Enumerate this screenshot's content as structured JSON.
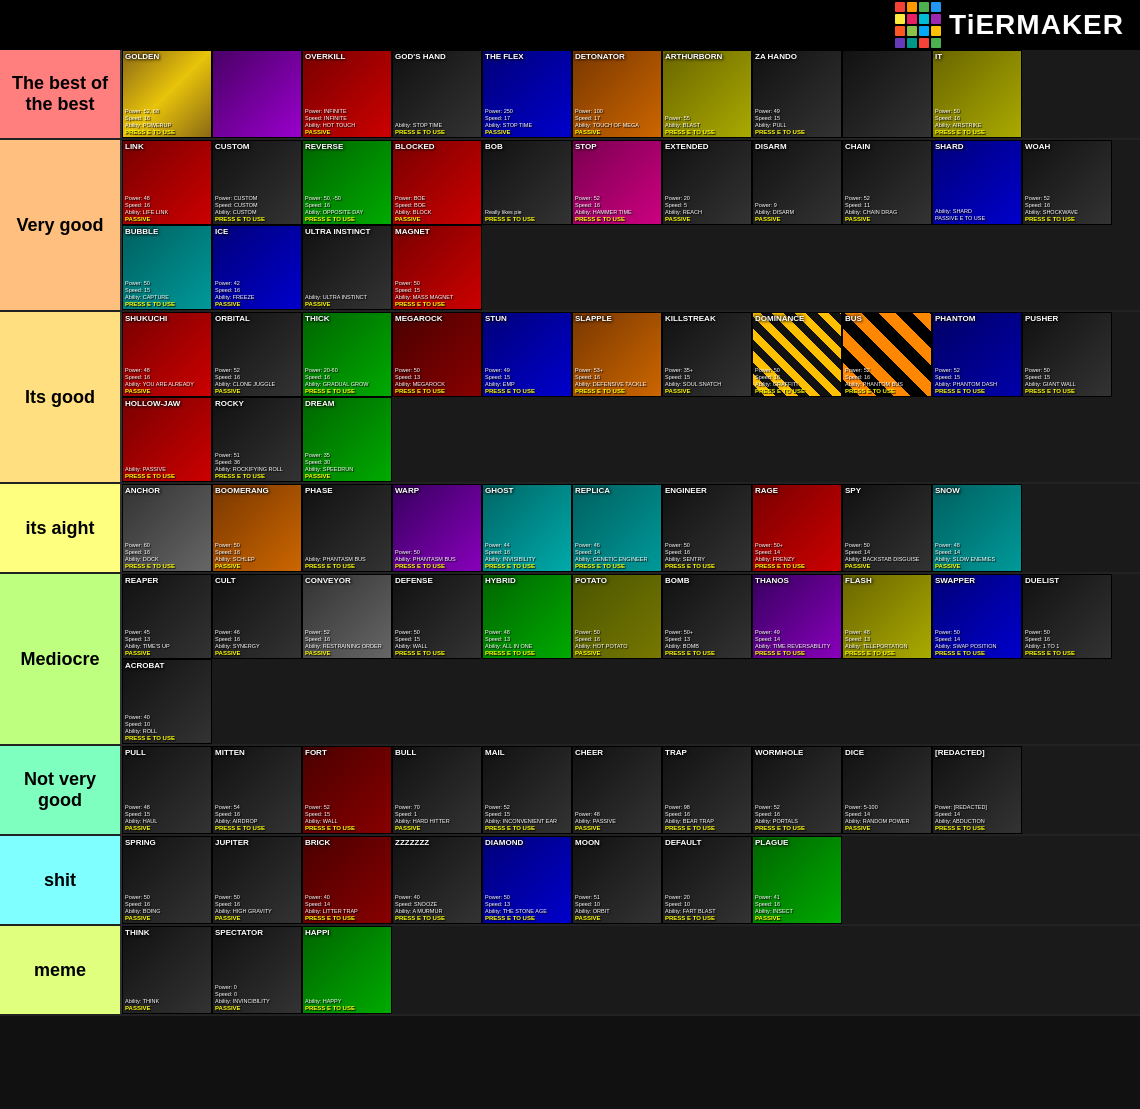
{
  "header": {
    "title": "TiERMAKER",
    "logo_colors": [
      "#f44",
      "#f84",
      "#4f4",
      "#44f",
      "#ff4",
      "#f4f",
      "#4ff",
      "#fff",
      "#f44",
      "#4f4",
      "#44f",
      "#ff4",
      "#f4f",
      "#4ff",
      "#f44",
      "#4f4"
    ]
  },
  "tiers": [
    {
      "id": "s",
      "label": "The best of the best",
      "color": "#ff7f7f",
      "items": [
        {
          "name": "GOLDEN",
          "stats": "Power: 52, 68\nSpeed: 16\nAbility: POWERUP\nPRESS E TO USE",
          "bg": "golden"
        },
        {
          "name": "",
          "stats": "",
          "bg": "purple-checker"
        },
        {
          "name": "OVERKILL",
          "stats": "Power: INFINITE\nSpeed: INFINITE\nAbility: HOT TOUCH\nPASSIVE",
          "bg": "red"
        },
        {
          "name": "GOD'S HAND",
          "stats": "Ability: STOP TIME\nPRESS E TO USE",
          "bg": "dark"
        },
        {
          "name": "THE FLEX",
          "stats": "Power: 250\nSpeed: 17\nAbility: STOP TIME\nPASSIVE",
          "bg": "blue"
        },
        {
          "name": "DETONATOR",
          "stats": "Power: 100\nSpeed: 17\nAbility: TOUCH OF MEGA\nPASSIVE",
          "bg": "orange"
        },
        {
          "name": "ARTHURBORN",
          "stats": "Power: 55\nAbility: BLAST\nPRESS E TO USE",
          "bg": "yellow"
        },
        {
          "name": "ZA HANDO",
          "stats": "Power: 49\nSpeed: 15\nAbility: PULL\nPRESS E TO USE",
          "bg": "dark"
        },
        {
          "name": "",
          "stats": "",
          "bg": "dark"
        },
        {
          "name": "IT",
          "stats": "Power: 50\nSpeed: 16\nAbility: AIRSTRIKE\nPRESS E TO USE",
          "bg": "yellow"
        }
      ]
    },
    {
      "id": "a",
      "label": "Very good",
      "color": "#ffbf7f",
      "items": [
        {
          "name": "LINK",
          "stats": "Power: 48\nSpeed: 16\nAbility: LIFE LINK\nPASSIVE",
          "bg": "red"
        },
        {
          "name": "CUSTOM",
          "stats": "Power: CUSTOM\nSpeed: CUSTOM\nAbility: CUSTOM\nPRESS E TO USE",
          "bg": "dark"
        },
        {
          "name": "REVERSE",
          "stats": "Power: 50, -50\nSpeed: 16\nAbility: OPPOSITE DAY\nPRESS E TO USE",
          "bg": "green"
        },
        {
          "name": "BLOCKED",
          "stats": "Power: BOE\nSpeed: BOE\nAbility: BLOCK\nPASSIVE",
          "bg": "red"
        },
        {
          "name": "BOB",
          "stats": "Really likes pie\nPRESS E TO USE",
          "bg": "dark"
        },
        {
          "name": "STOP",
          "stats": "Power: 52\nSpeed: 16\nAbility: HAMMER TIME\nPRESS E TO USE",
          "bg": "pink"
        },
        {
          "name": "EXTENDED",
          "stats": "Power: 20\nSpeed: 5\nAbility: REACH\nPASSIVE",
          "bg": "dark"
        },
        {
          "name": "DISARM",
          "stats": "Power: 9\nAbility: DISARM\nPASSIVE",
          "bg": "dark"
        },
        {
          "name": "CHAIN",
          "stats": "Power: 52\nSpeed: 11\nAbility: CHAIN DRAG\nPASSIVE",
          "bg": "dark"
        },
        {
          "name": "SHARD",
          "stats": "Ability: SHARD\nPASSIVE E TO USE",
          "bg": "blue"
        },
        {
          "name": "WOAH",
          "stats": "Power: 52\nSpeed: 16\nAbility: SHOCKWAVE\nPRESS E TO USE",
          "bg": "dark"
        },
        {
          "name": "BUBBLE",
          "stats": "Power: 50\nSpeed: 15\nAbility: CAPTURE\nPRESS E TO USE",
          "bg": "cyan"
        },
        {
          "name": "ICE",
          "stats": "Power: 42\nSpeed: 16\nAbility: FREEZE\nPASSIVE",
          "bg": "blue"
        },
        {
          "name": "ULTRA INSTINCT",
          "stats": "Ability: ULTRA INSTINCT\nPASSIVE",
          "bg": "dark"
        },
        {
          "name": "MAGNET",
          "stats": "Power: 50\nSpeed: 15\nAbility: MASS MAGNET\nPRESS E TO USE",
          "bg": "red"
        }
      ]
    },
    {
      "id": "b",
      "label": "Its good",
      "color": "#ffdf7f",
      "items": [
        {
          "name": "SHUKUCHI",
          "stats": "Power: 48\nSpeed: 16\nAbility: YOU ARE ALREADY\nPASSIVE",
          "bg": "red"
        },
        {
          "name": "ORBITAL",
          "stats": "Power: 52\nSpeed: 16\nAbility: CLONE JUGGLE\nPASSIVE",
          "bg": "dark"
        },
        {
          "name": "THICK",
          "stats": "Power: 20-60\nSpeed: 16\nAbility: GRADUAL GROW\nPRESS E TO USE",
          "bg": "green"
        },
        {
          "name": "MEGAROCK",
          "stats": "Power: 50\nSpeed: 13\nAbility: MEGAROCK\nPRESS E TO USE",
          "bg": "maroon"
        },
        {
          "name": "STUN",
          "stats": "Power: 49\nSpeed: 15\nAbility: EMP\nPRESS E TO USE",
          "bg": "blue"
        },
        {
          "name": "SLAPPLE",
          "stats": "Power: 53+\nSpeed: 16\nAbility: DEFENSIVE TACKLE\nPRESS E TO USE",
          "bg": "orange"
        },
        {
          "name": "KILLSTREAK",
          "stats": "Power: 35+\nSpeed: 15\nAbility: SOUL SNATCH\nPASSIVE",
          "bg": "dark"
        },
        {
          "name": "DOMINANCE",
          "stats": "Power: 50\nSpeed: 16\nAbility: GRAFFITI\nPRESS E TO USE",
          "bg": "stripe"
        },
        {
          "name": "BUS",
          "stats": "Power: 52\nSpeed: 16\nAbility: PHANTOM BUS\nPRESS E TO USE",
          "bg": "checker"
        },
        {
          "name": "PHANTOM",
          "stats": "Power: 52\nSpeed: 15\nAbility: PHANTOM DASH\nPRESS E TO USE",
          "bg": "navy"
        },
        {
          "name": "PUSHER",
          "stats": "Power: 50\nSpeed: 15\nAbility: GIANT WALL\nPRESS E TO USE",
          "bg": "dark"
        },
        {
          "name": "HOLLOW-JAW",
          "stats": "Ability: PASSIVE\nPRESS E TO USE",
          "bg": "red"
        },
        {
          "name": "ROCKY",
          "stats": "Power: 51\nSpeed: 36\nAbility: ROCKIFYING ROLL\nPRESS E TO USE",
          "bg": "dark"
        },
        {
          "name": "DREAM",
          "stats": "Power: 35\nSpeed: 30\nAbility: SPEEDRUN\nPASSIVE",
          "bg": "green"
        }
      ]
    },
    {
      "id": "c",
      "label": "its aight",
      "color": "#ffff7f",
      "items": [
        {
          "name": "ANCHOR",
          "stats": "Power: 60\nSpeed: 16\nAbility: DOCK\nPRESS E TO USE",
          "bg": "gray"
        },
        {
          "name": "BOOMERANG",
          "stats": "Power: 50\nSpeed: 16\nAbility: SCHLEP\nPASSIVE",
          "bg": "orange"
        },
        {
          "name": "PHASE",
          "stats": "Ability: PHANTASM BUS\nPRESS E TO USE",
          "bg": "dark"
        },
        {
          "name": "WARP",
          "stats": "Power: 50\nAbility: PHANTASM BUS\nPRESS E TO USE",
          "bg": "purple"
        },
        {
          "name": "GHOST",
          "stats": "Power: 44\nSpeed: 16\nAbility: INVISIBILITY\nPRESS E TO USE",
          "bg": "teal"
        },
        {
          "name": "REPLICA",
          "stats": "Power: 46\nSpeed: 14\nAbility: GENETIC ENGINEER\nPRESS E TO USE",
          "bg": "cyan"
        },
        {
          "name": "ENGINEER",
          "stats": "Power: 50\nSpeed: 16\nAbility: SENTRY\nPRESS E TO USE",
          "bg": "dark"
        },
        {
          "name": "RAGE",
          "stats": "Power: 50+\nSpeed: 14\nAbility: FRENZY\nPRESS E TO USE",
          "bg": "red"
        },
        {
          "name": "SPY",
          "stats": "Power: 50\nSpeed: 14\nAbility: BACKSTAB DISGUISE\nPASSIVE",
          "bg": "dark"
        },
        {
          "name": "SNOW",
          "stats": "Power: 48\nSpeed: 14\nAbility: SLOW ENEMIES\nPASSIVE",
          "bg": "cyan"
        }
      ]
    },
    {
      "id": "d",
      "label": "Mediocre",
      "color": "#bfff7f",
      "items": [
        {
          "name": "REAPER",
          "stats": "Power: 45\nSpeed: 13\nAbility: TIME'S UP\nPASSIVE",
          "bg": "dark"
        },
        {
          "name": "CULT",
          "stats": "Power: 46\nSpeed: 16\nAbility: SYNERGY\nPASSIVE",
          "bg": "dark"
        },
        {
          "name": "CONVEYOR",
          "stats": "Power: 52\nSpeed: 16\nAbility: RESTRAINING ORDER\nPASSIVE",
          "bg": "gray"
        },
        {
          "name": "DEFENSE",
          "stats": "Power: 50\nSpeed: 15\nAbility: WALL\nPRESS E TO USE",
          "bg": "dark"
        },
        {
          "name": "HYBRID",
          "stats": "Power: 48\nSpeed: 13\nAbility: ALL IN ONE\nPRESS E TO USE",
          "bg": "green"
        },
        {
          "name": "POTATO",
          "stats": "Power: 50\nSpeed: 16\nAbility: HOT POTATO\nPASSIVE",
          "bg": "olive"
        },
        {
          "name": "BOMB",
          "stats": "Power: 50+\nSpeed: 13\nAbility: BOMB\nPRESS E TO USE",
          "bg": "dark"
        },
        {
          "name": "THANOS",
          "stats": "Power: 49\nSpeed: 14\nAbility: TIME REVERSABILITY\nPRESS E TO USE",
          "bg": "purple"
        },
        {
          "name": "FLASH",
          "stats": "Power: 48\nSpeed: 13\nAbility: TELEPORTATION\nPRESS E TO USE",
          "bg": "yellow"
        },
        {
          "name": "SWAPPER",
          "stats": "Power: 50\nSpeed: 14\nAbility: SWAP POSITION\nPRESS E TO USE",
          "bg": "blue"
        },
        {
          "name": "DUELIST",
          "stats": "Power: 50\nSpeed: 16\nAbility: 1 TO 1\nPRESS E TO USE",
          "bg": "dark"
        },
        {
          "name": "ACROBAT",
          "stats": "Power: 40\nSpeed: 10\nAbility: ROLL\nPRESS E TO USE",
          "bg": "dark"
        }
      ]
    },
    {
      "id": "e",
      "label": "Not very good",
      "color": "#7fffbf",
      "items": [
        {
          "name": "PULL",
          "stats": "Power: 48\nSpeed: 15\nAbility: HAUL\nPASSIVE",
          "bg": "dark"
        },
        {
          "name": "MITTEN",
          "stats": "Power: 54\nSpeed: 16\nAbility: AIRDROP\nPRESS E TO USE",
          "bg": "dark"
        },
        {
          "name": "FORT",
          "stats": "Power: 52\nSpeed: 15\nAbility: WALL\nPRESS E TO USE",
          "bg": "maroon"
        },
        {
          "name": "BULL",
          "stats": "Power: 70\nSpeed: 1\nAbility: HARD HITTER\nPASSIVE",
          "bg": "dark"
        },
        {
          "name": "MAIL",
          "stats": "Power: 52\nSpeed: 15\nAbility: INCONVENIENT EAR\nPRESS E TO USE",
          "bg": "dark"
        },
        {
          "name": "CHEER",
          "stats": "Power: 48\nAbility: PASSIVE\nPASSIVE",
          "bg": "dark"
        },
        {
          "name": "TRAP",
          "stats": "Power: 98\nSpeed: 16\nAbility: BEAR TRAP\nPRESS E TO USE",
          "bg": "dark"
        },
        {
          "name": "WORMHOLE",
          "stats": "Power: 52\nSpeed: 16\nAbility: PORTALS\nPRESS E TO USE",
          "bg": "dark"
        },
        {
          "name": "DICE",
          "stats": "Power: 5-100\nSpeed: 14\nAbility: RANDOM POWER\nPASSIVE",
          "bg": "dark"
        },
        {
          "name": "[REDACTED]",
          "stats": "Power: [REDACTED]\nSpeed: 14\nAbility: ABDUCTION\nPRESS E TO USE",
          "bg": "dark"
        }
      ]
    },
    {
      "id": "f",
      "label": "shit",
      "color": "#7fffff",
      "items": [
        {
          "name": "SPRING",
          "stats": "Power: 50\nSpeed: 16\nAbility: BOING\nPASSIVE",
          "bg": "dark"
        },
        {
          "name": "JUPITER",
          "stats": "Power: 50\nSpeed: 16\nAbility: HIGH GRAVITY\nPASSIVE",
          "bg": "dark"
        },
        {
          "name": "BRICK",
          "stats": "Power: 40\nSpeed: 14\nAbility: LITTER TRAP\nPRESS E TO USE",
          "bg": "maroon"
        },
        {
          "name": "ZZZZZZZ",
          "stats": "Power: 40\nSpeed: SNOOZE\nAbility: A MURMUR\nPRESS E TO USE",
          "bg": "dark"
        },
        {
          "name": "DIAMOND",
          "stats": "Power: 50\nSpeed: 13\nAbility: THE STONE AGE\nPRESS E TO USE",
          "bg": "blue"
        },
        {
          "name": "MOON",
          "stats": "Power: 51\nSpeed: 10\nAbility: ORBIT\nPASSIVE",
          "bg": "dark"
        },
        {
          "name": "DEFAULT",
          "stats": "Power: 20\nSpeed: 10\nAbility: FART BLAST\nPRESS E TO USE",
          "bg": "dark"
        },
        {
          "name": "PLAGUE",
          "stats": "Power: 41\nSpeed: 16\nAbility: INSECT\nPASSIVE",
          "bg": "green"
        }
      ]
    },
    {
      "id": "g",
      "label": "meme",
      "color": "#e0ff7f",
      "items": [
        {
          "name": "THINK",
          "stats": "Ability: THINK\nPASSIVE",
          "bg": "dark"
        },
        {
          "name": "SPECTATOR",
          "stats": "Power: 0\nSpeed: 0\nAbility: INVINCIBILITY\nPASSIVE",
          "bg": "dark"
        },
        {
          "name": "HAPPI",
          "stats": "Ability: HAPPY\nPRESS E TO USE",
          "bg": "green"
        }
      ]
    }
  ]
}
